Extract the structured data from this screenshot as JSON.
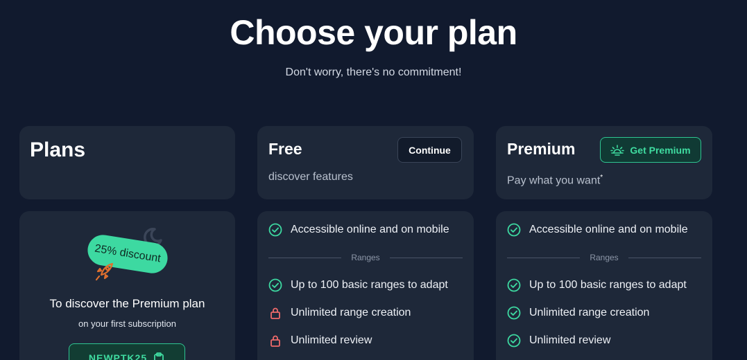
{
  "header": {
    "title": "Choose your plan",
    "subtitle": "Don't worry, there's no commitment!"
  },
  "plans_card": {
    "title": "Plans"
  },
  "free": {
    "name": "Free",
    "description": "discover features",
    "button_label": "Continue",
    "features_top": [
      {
        "label": "Accessible online and on mobile",
        "status": "included"
      }
    ],
    "divider_label": "Ranges",
    "features_ranges": [
      {
        "label": "Up to 100 basic ranges to adapt",
        "status": "included"
      },
      {
        "label": "Unlimited range creation",
        "status": "locked"
      },
      {
        "label": "Unlimited review",
        "status": "locked"
      }
    ]
  },
  "premium": {
    "name": "Premium",
    "description": "Pay what you want",
    "description_mark": "*",
    "button_label": "Get Premium",
    "button_icon": "sun-icon",
    "features_top": [
      {
        "label": "Accessible online and on mobile",
        "status": "included"
      }
    ],
    "divider_label": "Ranges",
    "features_ranges": [
      {
        "label": "Up to 100 basic ranges to adapt",
        "status": "included"
      },
      {
        "label": "Unlimited range creation",
        "status": "included"
      },
      {
        "label": "Unlimited review",
        "status": "included"
      }
    ]
  },
  "promo": {
    "badge": "25% discount",
    "title": "To discover the Premium plan",
    "subtitle": "on your first subscription",
    "code": "NEWPTK25",
    "code_icon": "clipboard-icon"
  },
  "colors": {
    "background": "#111a2e",
    "card": "#1e2839",
    "accent": "#3dd9a1",
    "locked": "#f06b6b"
  }
}
